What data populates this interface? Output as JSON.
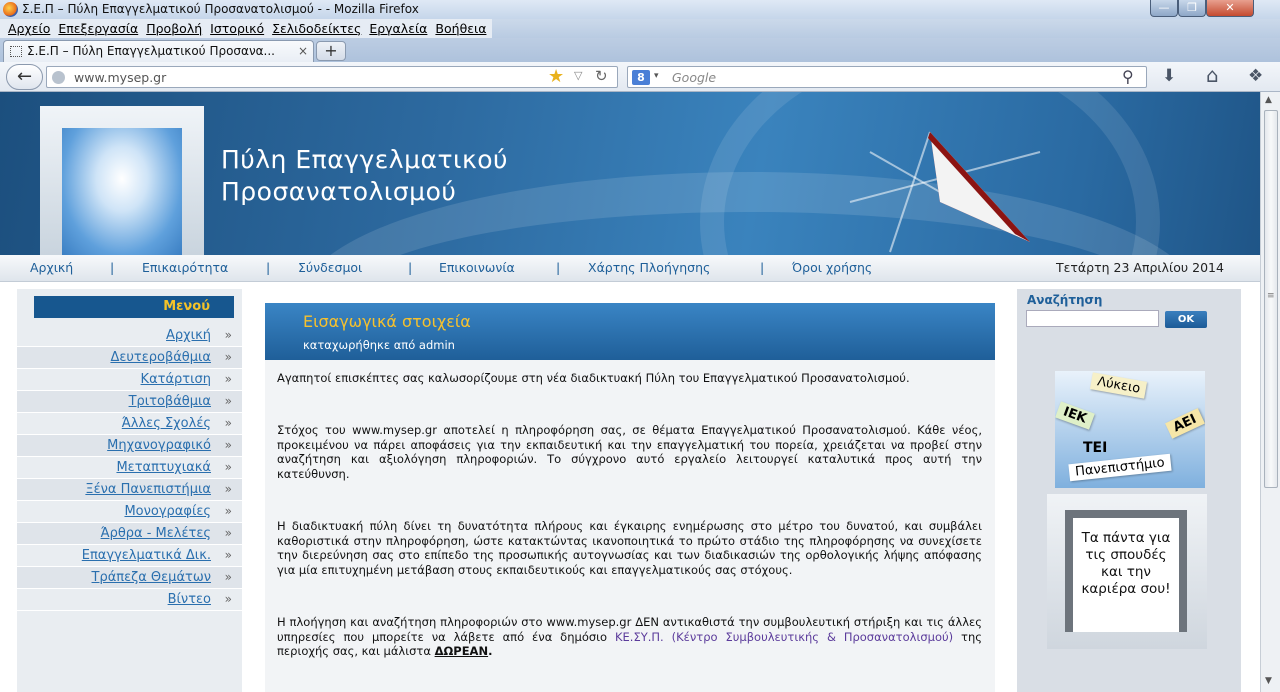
{
  "window": {
    "title": "Σ.Ε.Π – Πύλη Επαγγελματικού Προσανατολισμού - - Mozilla Firefox",
    "min_glyph": "—",
    "max_glyph": "❐",
    "close_glyph": "✕"
  },
  "menubar": [
    "Αρχείο",
    "Επεξεργασία",
    "Προβολή",
    "Ιστορικό",
    "Σελιδοδείκτες",
    "Εργαλεία",
    "Βοήθεια"
  ],
  "tab": {
    "label": "Σ.Ε.Π – Πύλη Επαγγελματικού Προσανα...",
    "close_glyph": "×",
    "new_tab_glyph": "+"
  },
  "navbar": {
    "back_glyph": "←",
    "url": "www.mysep.gr",
    "star_glyph": "★",
    "dropdown_glyph": "▽",
    "reload_glyph": "↻",
    "search_engine_glyph": "8",
    "search_dropdown_glyph": "▾",
    "search_placeholder": "Google",
    "search_icon_glyph": "⚲",
    "download_glyph": "⬇",
    "home_glyph": "⌂",
    "addon_glyph": "❖"
  },
  "site": {
    "title_line1": "Πύλη Επαγγελματικού",
    "title_line2": "Προσανατολισμού"
  },
  "topnav": {
    "items": [
      "Αρχική",
      "Επικαιρότητα",
      "Σύνδεσμοι",
      "Επικοινωνία",
      "Χάρτης Πλοήγησης",
      "Όροι χρήσης"
    ],
    "separator": "|",
    "date": "Τετάρτη 23 Απριλίου 2014"
  },
  "sidebar": {
    "heading": "Μενού",
    "arrow": "»",
    "items": [
      "Αρχική",
      "Δευτεροβάθμια",
      "Κατάρτιση",
      "Τριτοβάθμια",
      "Άλλες Σχολές",
      "Μηχανογραφικό",
      "Μεταπτυχιακά",
      "Ξένα Πανεπιστήμια",
      "Μονογραφίες",
      "Άρθρα - Μελέτες",
      "Επαγγελματικά Δικ.",
      "Τράπεζα Θεμάτων",
      "Βίντεο"
    ]
  },
  "article": {
    "title": "Εισαγωγικά στοιχεία",
    "meta": "καταχωρήθηκε από admin",
    "p1": "Αγαπητοί επισκέπτες  σας καλωσορίζουμε στη νέα διαδικτυακή Πύλη του Επαγγελματικού Προσανατολισμού.",
    "p2": "Στόχος του www.mysep.gr  αποτελεί  η πληροφόρηση  σας,  σε θέματα Επαγγελματικού Προσανατολισμού.  Κάθε νέος, προκειμένου να πάρει αποφάσεις για την εκπαιδευτική και την επαγγελματική  του  πορεία,  χρειάζεται  να  προβεί  στην    αναζήτηση  και  αξιολόγηση πληροφοριών.  Το  σύγχρονο  αυτό  εργαλείο  λειτουργεί  καταλυτικά  προς    αυτή  την κατεύθυνση.",
    "p3": "Η διαδικτυακή πύλη δίνει  τη δυνατότητα πλήρους και έγκαιρης ενημέρωσης στο μέτρο του δυνατού, και συμβάλει καθοριστικά στην πληροφόρηση,  ώστε κατακτώντας ικανοποιητικά το πρώτο  στάδιο  της  πληροφόρησης   να  συνεχίσετε   την  διερεύνηση  σας  στο  επίπεδο  της προσωπικής αυτογνωσίας  και των διαδικασιών της ορθολογικής λήψης απόφασης  για μία επιτυχημένη μετάβαση στους εκπαιδευτικούς και επαγγελματικούς σας  στόχους.",
    "p4_before": "Η  πλοήγηση  και  αναζήτηση  πληροφοριών    στο  www.mysep.gr    ΔΕΝ  αντικαθιστά    την συμβουλευτική στήριξη και τις άλλες υπηρεσίες που μπορείτε να λάβετε από ένα δημόσιο ",
    "p4_link": "ΚΕ.ΣΥ.Π.   (Κέντρο Συμβουλευτικής & Προσανατολισμού)",
    "p4_after": "  της περιοχής σας, και μάλιστα ",
    "p4_bold": "ΔΩΡΕΑΝ",
    "p4_end": "."
  },
  "right": {
    "search_label": "Αναζήτηση",
    "search_button": "ΟΚ",
    "cards": [
      "Λύκειο",
      "ΙΕΚ",
      "ΑΕΙ",
      "ΤΕΙ",
      "Πανεπιστήμιο"
    ],
    "promo": "Τα πάντα για τις σπουδές και την καριέρα σου!"
  },
  "scroll": {
    "up": "▲",
    "down": "▼",
    "grip": "≡"
  }
}
